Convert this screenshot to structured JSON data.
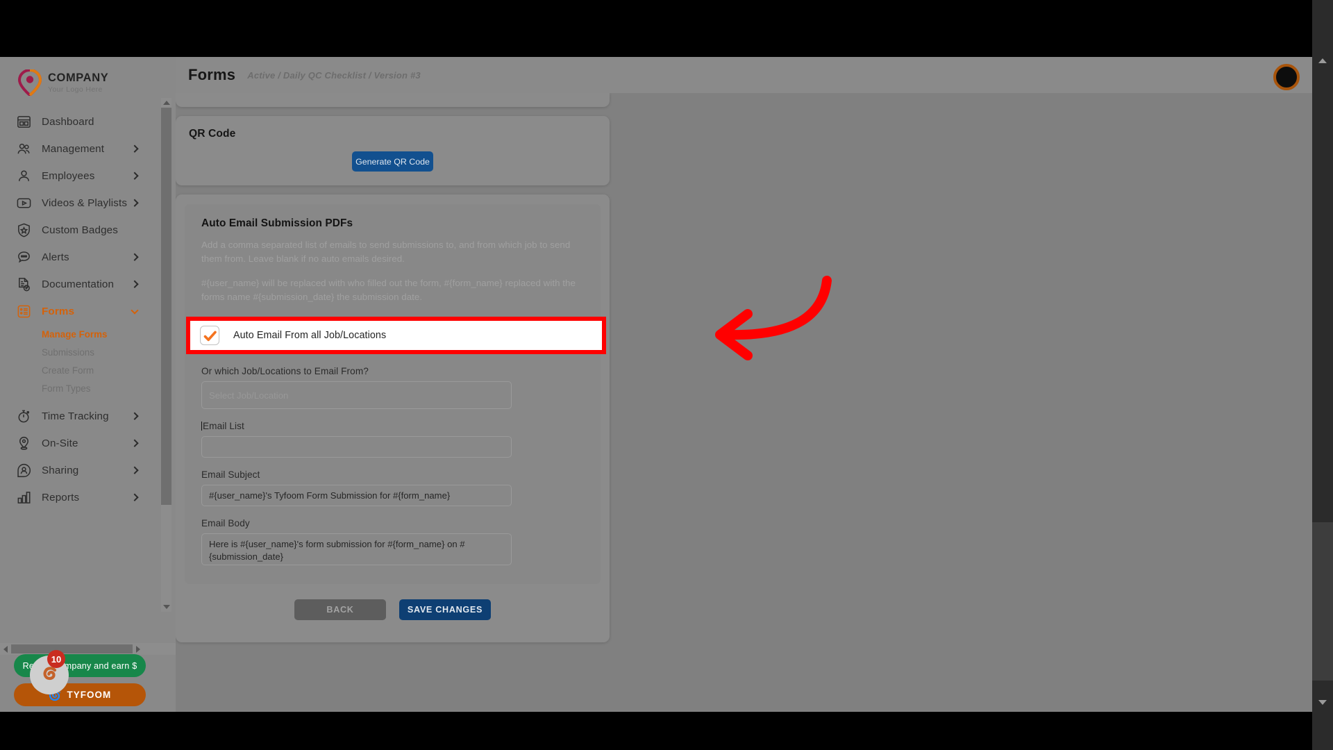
{
  "brand": {
    "name": "COMPANY",
    "tagline": "Your Logo Here"
  },
  "header": {
    "title": "Forms",
    "breadcrumb": "Active / Daily QC Checklist / Version #3"
  },
  "sidebar": {
    "items": [
      {
        "label": "Dashboard",
        "icon": "dashboard-icon",
        "expandable": false
      },
      {
        "label": "Management",
        "icon": "people-icon",
        "expandable": true
      },
      {
        "label": "Employees",
        "icon": "person-icon",
        "expandable": true
      },
      {
        "label": "Videos & Playlists",
        "icon": "video-icon",
        "expandable": true
      },
      {
        "label": "Custom Badges",
        "icon": "shield-star-icon",
        "expandable": false
      },
      {
        "label": "Alerts",
        "icon": "chat-alert-icon",
        "expandable": true
      },
      {
        "label": "Documentation",
        "icon": "document-check-icon",
        "expandable": true
      },
      {
        "label": "Forms",
        "icon": "form-list-icon",
        "expandable": true,
        "active": true
      },
      {
        "label": "Time Tracking",
        "icon": "stopwatch-icon",
        "expandable": true
      },
      {
        "label": "On-Site",
        "icon": "map-pin-icon",
        "expandable": true
      },
      {
        "label": "Sharing",
        "icon": "share-badge-icon",
        "expandable": true
      },
      {
        "label": "Reports",
        "icon": "bar-chart-icon",
        "expandable": true
      }
    ],
    "forms_subitems": [
      {
        "label": "Manage Forms",
        "active": true
      },
      {
        "label": "Submissions",
        "active": false
      },
      {
        "label": "Create Form",
        "active": false
      },
      {
        "label": "Form Types",
        "active": false
      }
    ],
    "promo": {
      "refer_label": "Refer a company and earn $",
      "refer_badge": "10",
      "tyfoom_label": "TYFOOM"
    }
  },
  "qr_section": {
    "title": "QR Code",
    "generate_label": "Generate QR Code"
  },
  "email_section": {
    "title": "Auto Email Submission PDFs",
    "desc1": "Add a comma separated list of emails to send submissions to, and from which job to send them from. Leave blank if no auto emails desired.",
    "desc2": "#{user_name} will be replaced with who filled out the form, #{form_name} replaced with the forms name #{submission_date} the submission date.",
    "checkbox": {
      "label": "Auto Email From all Job/Locations",
      "checked": true
    },
    "job_locations": {
      "label": "Or which Job/Locations to Email From?",
      "placeholder": "Select Job/Location",
      "value": "",
      "disabled": true
    },
    "email_list": {
      "label": "Email List",
      "value": ""
    },
    "email_subject": {
      "label": "Email Subject",
      "value": "#{user_name}'s Tyfoom Form Submission for #{form_name}"
    },
    "email_body": {
      "label": "Email Body",
      "value": "Here is #{user_name}'s form submission for #{form_name} on #{submission_date}"
    }
  },
  "actions": {
    "back_label": "BACK",
    "save_label": "SAVE CHANGES"
  },
  "annotation": {
    "arrow": "curved-left-arrow",
    "highlight_color": "#ff0000"
  },
  "colors": {
    "accent_orange": "#d4620a",
    "primary_blue": "#12508f",
    "save_blue": "#0e3f73",
    "promo_green": "#17874a",
    "promo_orange": "#b55508",
    "badge_red": "#c92c20"
  }
}
